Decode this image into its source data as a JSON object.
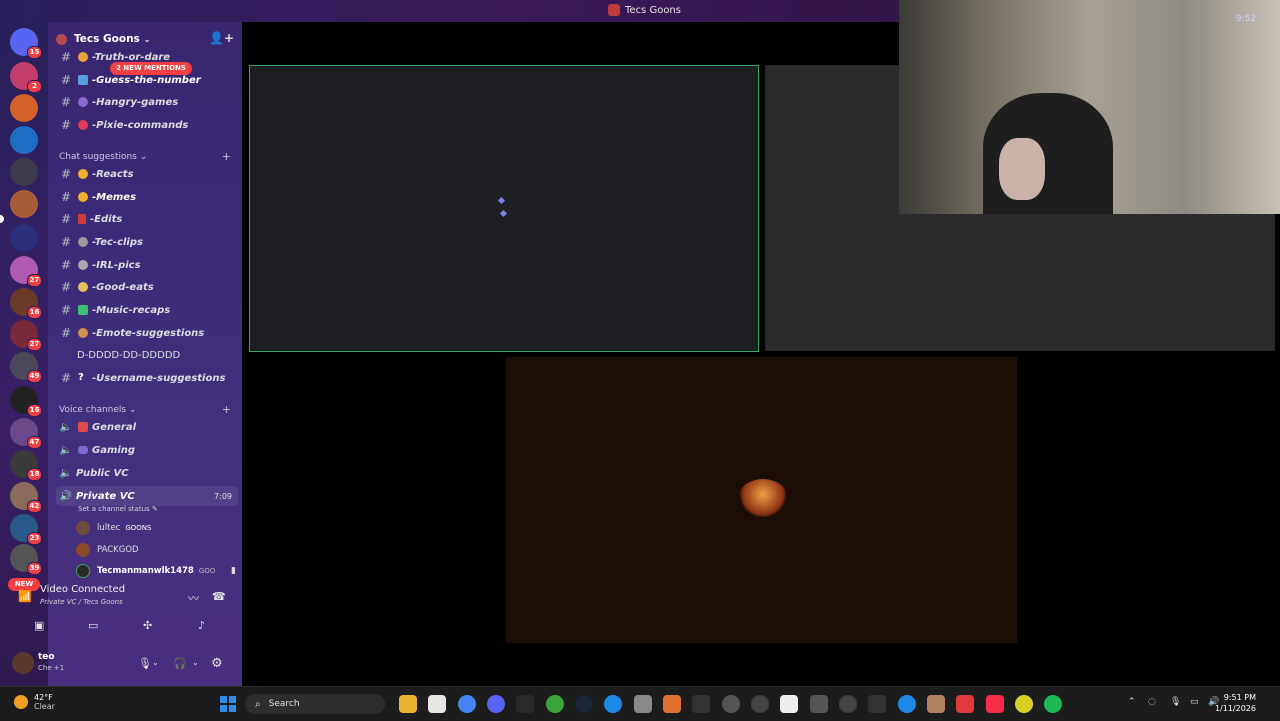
{
  "window": {
    "title": "Tecs Goons"
  },
  "server_badges": [
    "15",
    "2",
    "27",
    "16",
    "27",
    "49",
    "16",
    "47",
    "18",
    "42",
    "23",
    "39"
  ],
  "server_new": "NEW",
  "guild": {
    "name": "Tecs Goons",
    "mentions": "2 NEW MENTIONS"
  },
  "channels_top": [
    {
      "label": "-Truth-or-dare"
    },
    {
      "label": "-Guess-the-number"
    },
    {
      "label": "-Hangry-games"
    },
    {
      "label": "-Pixie-commands"
    }
  ],
  "chat_category": "Chat suggestions",
  "chat_channels": [
    {
      "label": "-Reacts"
    },
    {
      "label": "-Memes"
    },
    {
      "label": "-Edits"
    },
    {
      "label": "-Tec-clips"
    },
    {
      "label": "-IRL-pics"
    },
    {
      "label": "-Good-eats"
    },
    {
      "label": "-Music-recaps"
    },
    {
      "label": "-Emote-suggestions"
    },
    {
      "label": "D-DDDD-DD-DDDDD"
    },
    {
      "label": "-Username-suggestions"
    }
  ],
  "voice_category": "Voice channels",
  "voice_channels": [
    {
      "label": "General"
    },
    {
      "label": "Gaming"
    },
    {
      "label": "Public VC"
    },
    {
      "label": "Private VC",
      "time": "7:09"
    }
  ],
  "channel_status": "Set a channel status",
  "voice_users": [
    {
      "name": "lultec",
      "tag": "GOONS"
    },
    {
      "name": "PACKGOD",
      "tag": ""
    },
    {
      "name": "Tecmanmanwlk1478",
      "tag": "GOO"
    }
  ],
  "connection": {
    "status": "Video Connected",
    "location": "Private VC / Tecs Goons"
  },
  "user": {
    "name": "teo",
    "status": "Che +1"
  },
  "cam_overlay": "9:52",
  "taskbar": {
    "temp": "42°F",
    "condition": "Clear",
    "search_label": "Search",
    "time": "9:51 PM",
    "date": "1/11/2026"
  },
  "colors": {
    "accent": "#3ba55c",
    "mention": "#f23f43",
    "brand": "#5865f2"
  }
}
